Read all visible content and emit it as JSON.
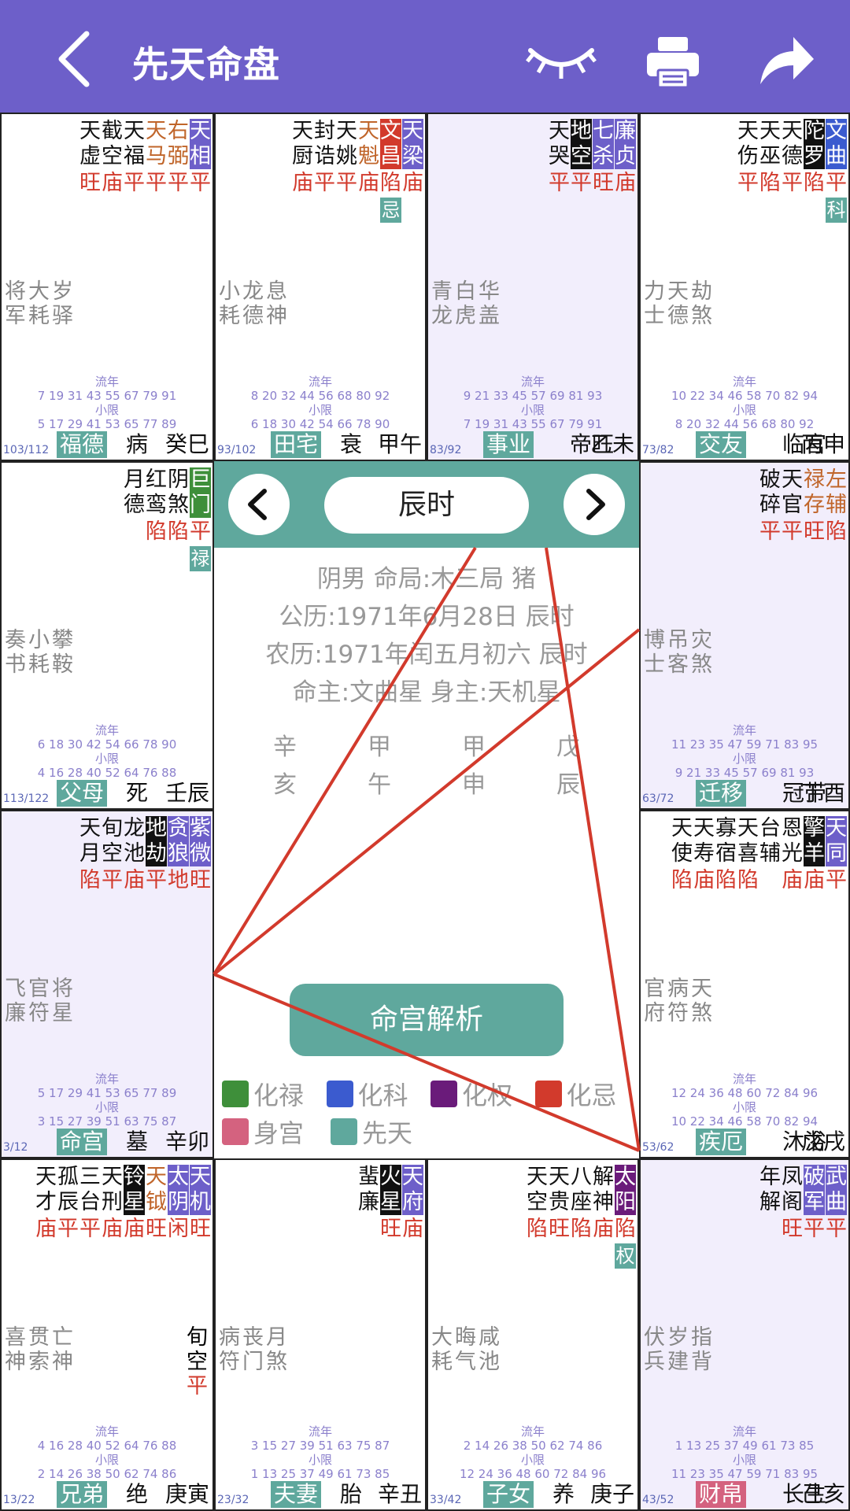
{
  "header": {
    "title": "先天命盘"
  },
  "icons": {
    "back": "chevron-left-icon",
    "eye": "eye-closed-icon",
    "print": "printer-icon",
    "share": "share-arrow-icon"
  },
  "colors": {
    "accent": "#6d5fc9",
    "teal": "#5fa89d",
    "brightness": "#d23a2c",
    "tint": "#f2eefc"
  },
  "palaces": [
    {
      "id": "si",
      "tinted": false,
      "stars": [
        {
          "chars": "天相",
          "badge": "#6d5fc9",
          "bright": "平"
        },
        {
          "chars": "右弼",
          "color": "#c0652a",
          "bright": "平"
        },
        {
          "chars": "天马",
          "color": "#c0652a",
          "bright": "平"
        },
        {
          "chars": "天福",
          "bright": "平"
        },
        {
          "chars": "截空",
          "bright": "庙"
        },
        {
          "chars": "天虚",
          "bright": "旺"
        }
      ],
      "minor": "将大岁军耗驿",
      "flow_years": "7 19 31 43 55 67 79 91",
      "small_limits": "5 17 29 41 53 65 77 89",
      "range": "103/112",
      "palace": "福德",
      "stage": "病",
      "stem": "癸巳"
    },
    {
      "id": "wu",
      "tinted": false,
      "stars": [
        {
          "chars": "天梁",
          "badge": "#6d5fc9",
          "bright": "庙"
        },
        {
          "chars": "文昌",
          "badge": "#d23a2c",
          "bright": "陷",
          "hua": "忌"
        },
        {
          "chars": "天魁",
          "color": "#c0652a",
          "bright": "庙"
        },
        {
          "chars": "天姚",
          "bright": "平"
        },
        {
          "chars": "封诰",
          "bright": "平"
        },
        {
          "chars": "天厨",
          "bright": "庙"
        }
      ],
      "minor": "小龙息耗德神",
      "flow_years": "8 20 32 44 56 68 80 92",
      "small_limits": "6 18 30 42 54 66 78 90",
      "range": "93/102",
      "palace": "田宅",
      "stage": "衰",
      "stem": "甲午"
    },
    {
      "id": "wei",
      "tinted": true,
      "stars": [
        {
          "chars": "廉贞",
          "badge": "#6d5fc9",
          "bright": "庙"
        },
        {
          "chars": "七杀",
          "badge": "#6d5fc9",
          "bright": "旺"
        },
        {
          "chars": "地空",
          "badge": "#111111",
          "bright": "平"
        },
        {
          "chars": "天哭",
          "bright": "平"
        }
      ],
      "minor": "青白华龙虎盖",
      "flow_years": "9 21 33 45 57 69 81 93",
      "small_limits": "7 19 31 43 55 67 79 91",
      "range": "83/92",
      "palace": "事业",
      "stage": "帝旺",
      "stem": "乙未"
    },
    {
      "id": "shen",
      "tinted": false,
      "stars": [
        {
          "chars": "文曲",
          "badge": "#3b5bcf",
          "bright": "平",
          "hua": "科"
        },
        {
          "chars": "陀罗",
          "badge": "#111111",
          "bright": "陷"
        },
        {
          "chars": "天德",
          "bright": "平"
        },
        {
          "chars": "天巫",
          "bright": "陷"
        },
        {
          "chars": "天伤",
          "bright": "平"
        }
      ],
      "minor": "力天劫士德煞",
      "flow_years": "10 22 34 46 58 70 82 94",
      "small_limits": "8 20 32 44 56 68 80 92",
      "range": "73/82",
      "palace": "交友",
      "stage": "临官",
      "stem": "丙申"
    },
    {
      "id": "chen",
      "tinted": false,
      "stars": [
        {
          "chars": "巨门",
          "badge": "#3e8f3a",
          "bright": "平",
          "hua": "禄"
        },
        {
          "chars": "阴煞",
          "bright": "陷"
        },
        {
          "chars": "红鸾",
          "bright": "陷"
        },
        {
          "chars": "月德",
          "bright": ""
        }
      ],
      "minor": "奏小攀书耗鞍",
      "flow_years": "6 18 30 42 54 66 78 90",
      "small_limits": "4 16 28 40 52 64 76 88",
      "range": "113/122",
      "palace": "父母",
      "stage": "死",
      "stem": "壬辰"
    },
    {
      "id": "you",
      "tinted": true,
      "stars": [
        {
          "chars": "左辅",
          "color": "#c0652a",
          "bright": "陷"
        },
        {
          "chars": "禄存",
          "color": "#c0652a",
          "bright": "旺"
        },
        {
          "chars": "天官",
          "bright": "平"
        },
        {
          "chars": "破碎",
          "bright": "平"
        }
      ],
      "minor": "博吊灾士客煞",
      "flow_years": "11 23 35 47 59 71 83 95",
      "small_limits": "9 21 33 45 57 69 81 93",
      "range": "63/72",
      "palace": "迁移",
      "stage": "冠带",
      "stem": "丁酉"
    },
    {
      "id": "mao",
      "tinted": true,
      "stars": [
        {
          "chars": "紫微",
          "badge": "#6d5fc9",
          "bright": "旺"
        },
        {
          "chars": "贪狼",
          "badge": "#6d5fc9",
          "bright": "地"
        },
        {
          "chars": "地劫",
          "badge": "#111111",
          "bright": "平"
        },
        {
          "chars": "龙池",
          "bright": "庙"
        },
        {
          "chars": "旬空",
          "bright": "平"
        },
        {
          "chars": "天月",
          "bright": "陷"
        }
      ],
      "minor": "飞官将廉符星",
      "flow_years": "5 17 29 41 53 65 77 89",
      "small_limits": "3 15 27 39 51 63 75 87",
      "range": "3/12",
      "palace": "命宫",
      "stage": "墓",
      "stem": "辛卯"
    },
    {
      "id": "xu",
      "tinted": false,
      "stars": [
        {
          "chars": "天同",
          "badge": "#6d5fc9",
          "bright": "平"
        },
        {
          "chars": "擎羊",
          "badge": "#111111",
          "bright": "庙"
        },
        {
          "chars": "恩光",
          "bright": "庙"
        },
        {
          "chars": "台辅",
          "bright": ""
        },
        {
          "chars": "天喜",
          "bright": "陷"
        },
        {
          "chars": "寡宿",
          "bright": "陷"
        },
        {
          "chars": "天寿",
          "bright": "庙"
        },
        {
          "chars": "天使",
          "bright": "陷"
        }
      ],
      "minor": "官病天府符煞",
      "flow_years": "12 24 36 48 60 72 84 96",
      "small_limits": "10 22 34 46 58 70 82 94",
      "range": "53/62",
      "palace": "疾厄",
      "stage": "沐浴",
      "stem": "戊戌"
    },
    {
      "id": "yin",
      "tinted": false,
      "stars": [
        {
          "chars": "天机",
          "badge": "#6d5fc9",
          "bright": "旺"
        },
        {
          "chars": "太阴",
          "badge": "#6d5fc9",
          "bright": "闲"
        },
        {
          "chars": "天钺",
          "color": "#c0652a",
          "bright": "旺"
        },
        {
          "chars": "铃星",
          "badge": "#111111",
          "bright": "庙"
        },
        {
          "chars": "天刑",
          "bright": "庙"
        },
        {
          "chars": "三台",
          "bright": "平"
        },
        {
          "chars": "孤辰",
          "bright": "平"
        },
        {
          "chars": "天才",
          "bright": "庙"
        }
      ],
      "minor": "喜贯亡神索神",
      "extra": "旬空平",
      "flow_years": "4 16 28 40 52 64 76 88",
      "small_limits": "2 14 26 38 50 62 74 86",
      "range": "13/22",
      "palace": "兄弟",
      "stage": "绝",
      "stem": "庚寅"
    },
    {
      "id": "chou",
      "tinted": false,
      "stars": [
        {
          "chars": "天府",
          "badge": "#6d5fc9",
          "bright": "庙"
        },
        {
          "chars": "火星",
          "badge": "#111111",
          "bright": "旺"
        },
        {
          "chars": "蜚廉",
          "bright": ""
        }
      ],
      "minor": "病丧月符门煞",
      "flow_years": "3 15 27 39 51 63 75 87",
      "small_limits": "1 13 25 37 49 61 73 85",
      "range": "23/32",
      "palace": "夫妻",
      "stage": "胎",
      "stem": "辛丑"
    },
    {
      "id": "zi",
      "tinted": false,
      "stars": [
        {
          "chars": "太阳",
          "badge": "#6a1b7a",
          "bright": "陷",
          "hua": "权"
        },
        {
          "chars": "解神",
          "bright": "庙"
        },
        {
          "chars": "八座",
          "bright": "陷"
        },
        {
          "chars": "天贵",
          "bright": "旺"
        },
        {
          "chars": "天空",
          "bright": "陷"
        }
      ],
      "minor": "大晦咸耗气池",
      "flow_years": "2 14 26 38 50 62 74 86",
      "small_limits": "12 24 36 48 60 72 84 96",
      "range": "33/42",
      "palace": "子女",
      "stage": "养",
      "stem": "庚子"
    },
    {
      "id": "hai",
      "tinted": true,
      "stars": [
        {
          "chars": "武曲",
          "badge": "#6d5fc9",
          "bright": "平"
        },
        {
          "chars": "破军",
          "badge": "#6d5fc9",
          "bright": "平"
        },
        {
          "chars": "凤阁",
          "bright": "旺"
        },
        {
          "chars": "年解",
          "bright": ""
        }
      ],
      "minor": "伏岁指兵建背",
      "flow_years": "1 13 25 37 49 61 73 85",
      "small_limits": "11 23 35 47 59 71 83 95",
      "range": "43/52",
      "palace": "财帛",
      "stage": "长生",
      "stem": "己亥",
      "palace_color": "#d4627f"
    }
  ],
  "labels": {
    "flow_year": "流年",
    "small_limit": "小限"
  },
  "center": {
    "time": "辰时",
    "line1": "阴男 命局:木三局 猪",
    "line2": "公历:1971年6月28日 辰时",
    "line3": "农历:1971年闰五月初六 辰时",
    "line4": "命主:文曲星 身主:天机星",
    "pillars": [
      {
        "top": "辛",
        "bottom": "亥"
      },
      {
        "top": "甲",
        "bottom": "午"
      },
      {
        "top": "甲",
        "bottom": "申"
      },
      {
        "top": "戊",
        "bottom": "辰"
      }
    ],
    "analyze": "命宫解析",
    "legend": [
      {
        "label": "化禄",
        "color": "#3e8f3a"
      },
      {
        "label": "化科",
        "color": "#3b5bcf"
      },
      {
        "label": "化权",
        "color": "#6a1b7a"
      },
      {
        "label": "化忌",
        "color": "#d23a2c"
      },
      {
        "label": "身宫",
        "color": "#d4627f"
      },
      {
        "label": "先天",
        "color": "#5fa89d"
      }
    ]
  }
}
